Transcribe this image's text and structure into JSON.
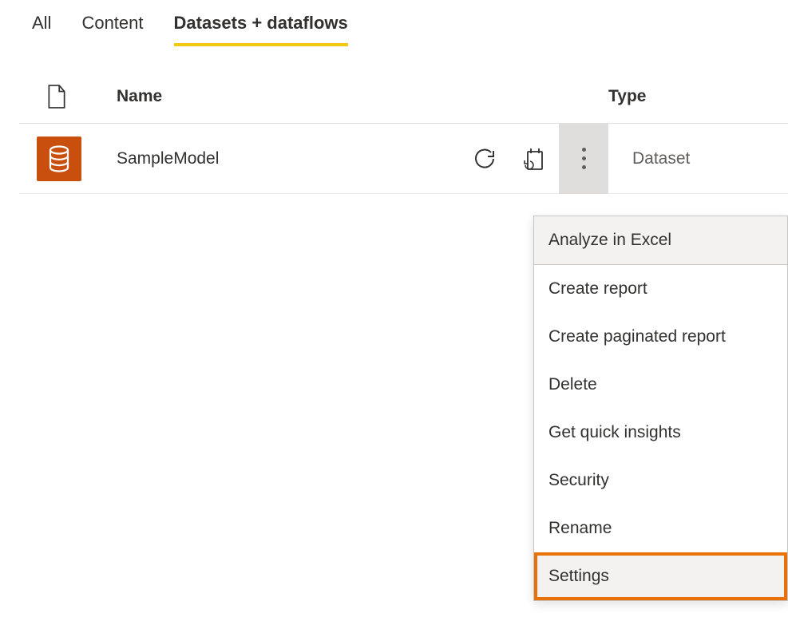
{
  "tabs": {
    "all": "All",
    "content": "Content",
    "datasets": "Datasets + dataflows"
  },
  "headers": {
    "name": "Name",
    "type": "Type"
  },
  "row": {
    "name": "SampleModel",
    "type": "Dataset"
  },
  "menu": {
    "analyze": "Analyze in Excel",
    "create_report": "Create report",
    "create_paginated": "Create paginated report",
    "delete": "Delete",
    "quick_insights": "Get quick insights",
    "security": "Security",
    "rename": "Rename",
    "settings": "Settings"
  }
}
